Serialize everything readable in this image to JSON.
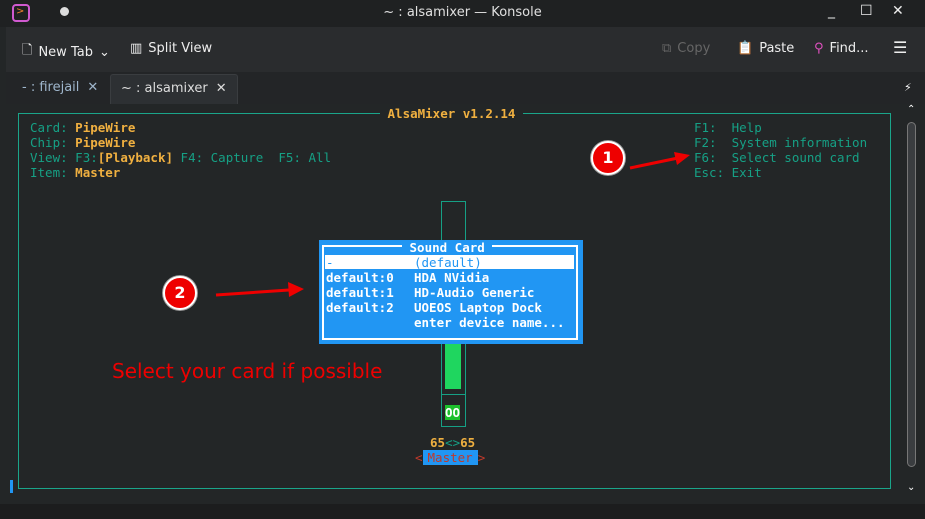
{
  "window": {
    "title": "~ : alsamixer — Konsole",
    "min": "_",
    "max": "☐",
    "close": "✕"
  },
  "toolbar": {
    "new_tab": "New Tab",
    "split_view": "Split View",
    "copy": "Copy",
    "paste": "Paste",
    "find": "Find..."
  },
  "tabs": [
    {
      "label": "- : firejail"
    },
    {
      "label": "~ : alsamixer"
    }
  ],
  "mixer": {
    "title": " AlsaMixer v1.2.14 ",
    "card_label": "Card:",
    "card": "PipeWire",
    "chip_label": "Chip:",
    "chip": "PipeWire",
    "view_label": "View:",
    "f3": "F3:",
    "playback": "[Playback]",
    "f4": "F4: Capture",
    "f5": "F5: All",
    "item_label": "Item:",
    "item": "Master",
    "help": [
      "F1:  Help",
      "F2:  System information",
      "F6:  Select sound card",
      "Esc: Exit"
    ],
    "mute": "OO",
    "volume": "65",
    "vol_sep": "<>",
    "channel": "Master",
    "larrow": "<",
    "rarrow": ">",
    "level_percent": 65
  },
  "dialog": {
    "title": " Sound Card ",
    "items": [
      {
        "id": "-",
        "name": "(default)"
      },
      {
        "id": "default:0",
        "name": "HDA NVidia"
      },
      {
        "id": "default:1",
        "name": "HD-Audio Generic"
      },
      {
        "id": "default:2",
        "name": "UOEOS Laptop Dock"
      },
      {
        "id": "",
        "name": "enter device name..."
      }
    ]
  },
  "annotations": {
    "one": "1",
    "two": "2",
    "note": "Select your card if possible"
  }
}
